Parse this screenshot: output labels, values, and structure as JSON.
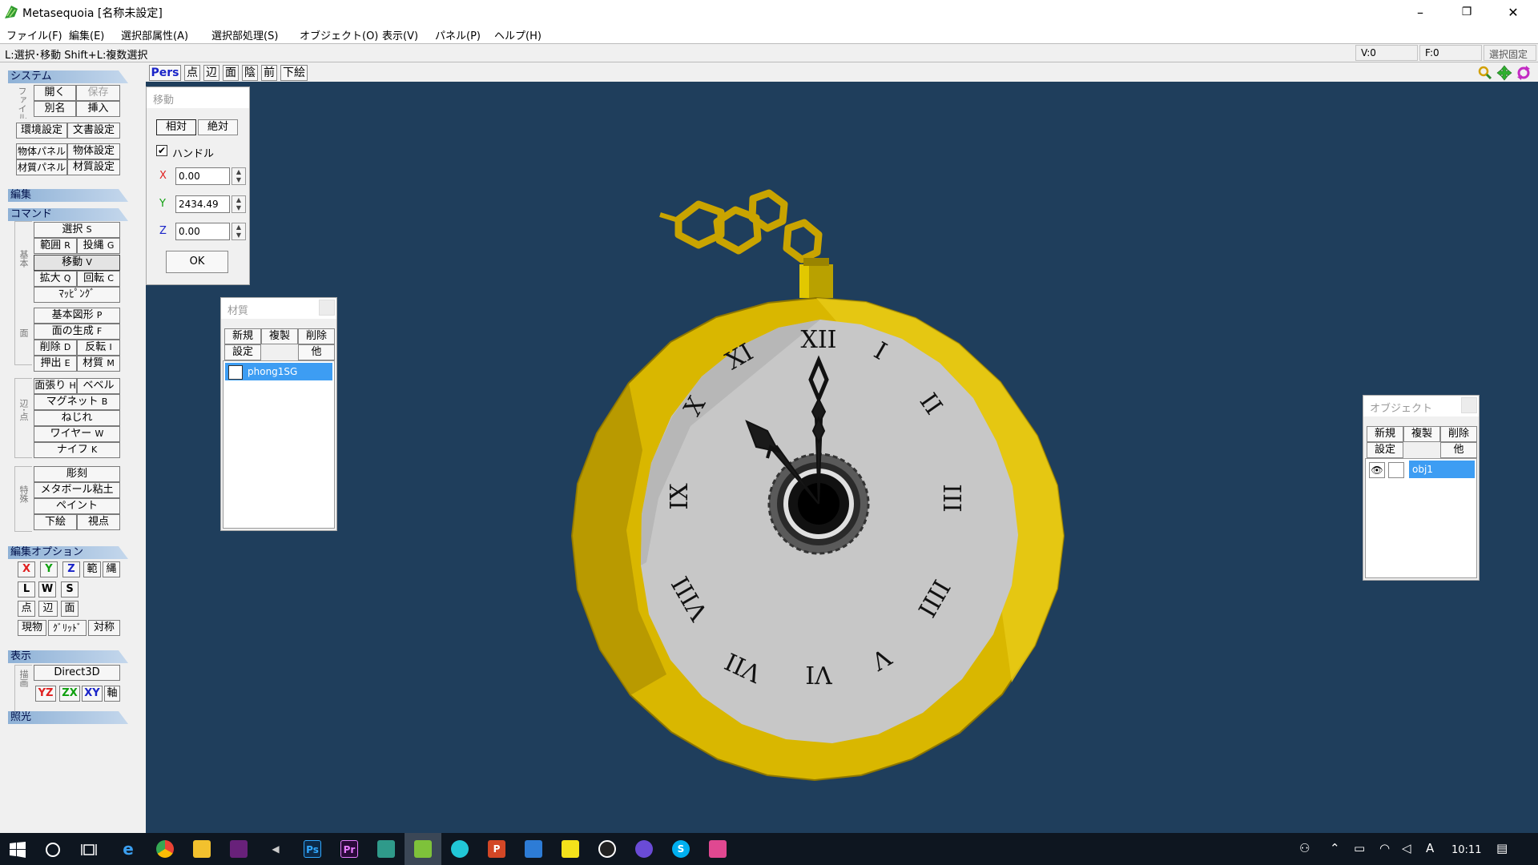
{
  "window": {
    "title": "Metasequoia [名称未設定]",
    "minimize": "–",
    "restore": "❐",
    "close": "✕"
  },
  "menus": [
    "ファイル(F)",
    "編集(E)",
    "選択部属性(A)",
    "選択部処理(S)",
    "オブジェクト(O)",
    "表示(V)",
    "パネル(P)",
    "ヘルプ(H)"
  ],
  "status": {
    "message": "L:選択･移動  Shift+L:複数選択",
    "vertices": "V:0",
    "faces": "F:0",
    "lock": "選択固定"
  },
  "left_panel": {
    "system": {
      "title": "システム",
      "file_label": "ファイル",
      "open": "開く",
      "save": "保存",
      "save_as": "別名",
      "insert": "挿入",
      "env_settings": "環境設定",
      "doc_settings": "文書設定",
      "obj_panel": "物体パネル",
      "obj_settings": "物体設定",
      "mat_panel": "材質パネル",
      "mat_settings": "材質設定"
    },
    "edit": {
      "title": "編集"
    },
    "command": {
      "title": "コマンド",
      "basic_label": "基本",
      "select": "選択",
      "select_key": "S",
      "range": "範囲",
      "range_key": "R",
      "lasso": "投縄",
      "lasso_key": "G",
      "move": "移動",
      "move_key": "V",
      "scale": "拡大",
      "scale_key": "Q",
      "rotate": "回転",
      "rotate_key": "C",
      "mapping": "ﾏｯﾋﾟﾝｸﾞ",
      "face_label": "面",
      "primitive": "基本図形",
      "primitive_key": "P",
      "face_gen": "面の生成",
      "face_gen_key": "F",
      "delete": "削除",
      "delete_key": "D",
      "flip": "反転",
      "flip_key": "I",
      "extrude": "押出",
      "extrude_key": "E",
      "material": "材質",
      "material_key": "M",
      "edge_label": "辺･点",
      "knife_face": "面張り",
      "knife_face_key": "H",
      "bevel": "ベベル",
      "magnet": "マグネット",
      "magnet_key": "B",
      "twist": "ねじれ",
      "wire": "ワイヤー",
      "wire_key": "W",
      "knife": "ナイフ",
      "knife_key": "K",
      "special_label": "特殊",
      "sculpt": "彫刻",
      "metaball": "メタボール粘土",
      "paint": "ペイント",
      "underlay": "下絵",
      "viewpoint": "視点"
    },
    "edit_options": {
      "title": "編集オプション",
      "x": "X",
      "y": "Y",
      "z": "Z",
      "range": "範",
      "lasso": "縄",
      "l": "L",
      "w": "W",
      "s": "S",
      "vertex": "点",
      "edge": "辺",
      "face": "面",
      "current": "現物",
      "grid": "ｸﾞﾘｯﾄﾞ",
      "symmetry": "対称"
    },
    "display": {
      "title": "表示",
      "render_label": "描画",
      "renderer": "Direct3D",
      "yz": "YZ",
      "zx": "ZX",
      "xy": "XY",
      "axis": "軸"
    },
    "lighting": {
      "title": "照光"
    }
  },
  "view_toolbar": {
    "pers": "Pers",
    "vertex": "点",
    "edge": "辺",
    "face": "面",
    "hidden": "陰",
    "front": "前",
    "underlay": "下絵",
    "icons": [
      "zoom-icon",
      "pan-icon",
      "rotate-view-icon"
    ]
  },
  "move_panel": {
    "title": "移動",
    "relative": "相対",
    "absolute": "絶対",
    "handle_label": "ハンドル",
    "handle_checked": true,
    "x_label": "X",
    "x_value": "0.00",
    "y_label": "Y",
    "y_value": "2434.49",
    "z_label": "Z",
    "z_value": "0.00",
    "ok": "OK"
  },
  "material_panel": {
    "title": "材質",
    "new": "新規",
    "copy": "複製",
    "delete": "削除",
    "settings": "設定",
    "other": "他",
    "items": [
      "phong1SG"
    ]
  },
  "object_panel": {
    "title": "オブジェクト",
    "new": "新規",
    "copy": "複製",
    "delete": "削除",
    "settings": "設定",
    "other": "他",
    "items": [
      "obj1"
    ]
  },
  "colors": {
    "viewport_bg": "#1f3e5c",
    "gold": "#d4b000",
    "dial": "#c8c8c8",
    "selection": "#3d9df3",
    "axis_x": "#e02020",
    "axis_y": "#10a010",
    "axis_z": "#1a24c8"
  },
  "taskbar": {
    "apps": [
      "windows-start-icon",
      "cortana-icon",
      "task-view-icon",
      "edge-icon",
      "chrome-icon",
      "file-explorer-icon",
      "visual-studio-icon",
      "media-icon",
      "photoshop-icon",
      "premiere-icon",
      "app-icon",
      "metasequoia-icon",
      "browser-icon",
      "powerpoint-icon",
      "calculator-icon",
      "notes-icon",
      "unreal-icon",
      "media-player-icon",
      "skype-icon",
      "app2-icon"
    ],
    "ps": "Ps",
    "pr": "Pr",
    "p": "P",
    "s": "S",
    "time": "10:11",
    "ime": "A"
  }
}
